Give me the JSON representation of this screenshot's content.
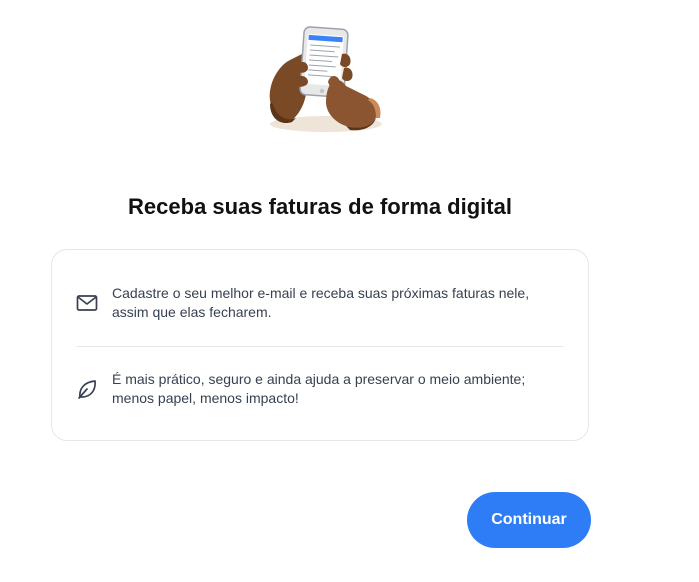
{
  "title": "Receba suas faturas de forma digital",
  "benefits": [
    {
      "icon": "mail-icon",
      "line1": "Cadastre o seu melhor e-mail e receba suas próximas faturas nele,",
      "line2": "assim que elas fecharem."
    },
    {
      "icon": "leaf-icon",
      "line1": "É mais prático, seguro e ainda ajuda a preservar o meio ambiente;",
      "line2": "menos papel, menos impacto!"
    }
  ],
  "continue_label": "Continuar",
  "colors": {
    "accent": "#2f7df6",
    "card_border": "#e5e7eb",
    "text": "#374151"
  }
}
